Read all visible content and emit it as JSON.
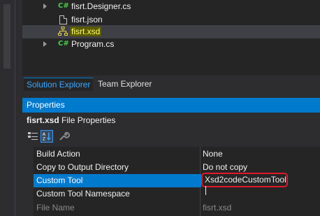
{
  "solution_explorer": {
    "items": [
      {
        "label": "fisrt.Designer.cs",
        "icon": "csharp-file-icon"
      },
      {
        "label": "fisrt.json",
        "icon": "json-file-icon"
      },
      {
        "label": "fisrt.xsd",
        "icon": "xsd-schema-icon",
        "selected": true
      },
      {
        "label": "Program.cs",
        "icon": "csharp-file-icon"
      }
    ],
    "cs_glyph": "C#"
  },
  "tabs": [
    {
      "label": "Solution Explorer",
      "active": true
    },
    {
      "label": "Team Explorer",
      "active": false
    }
  ],
  "properties": {
    "title": "Properties",
    "subject_name": "fisrt.xsd",
    "subject_type": "File Properties",
    "rows": [
      {
        "name": "Build Action",
        "value": "None"
      },
      {
        "name": "Copy to Output Directory",
        "value": "Do not copy"
      },
      {
        "name": "Custom Tool",
        "value": "Xsd2codeCustomTool",
        "selected": true,
        "editing": true
      },
      {
        "name": "Custom Tool Namespace",
        "value": ""
      },
      {
        "name": "File Name",
        "value": "fisrt.xsd",
        "disabled": true
      }
    ]
  },
  "colors": {
    "accent": "#007acc",
    "highlight": "#e0182a",
    "xsd_highlight": "#ffff6b"
  }
}
